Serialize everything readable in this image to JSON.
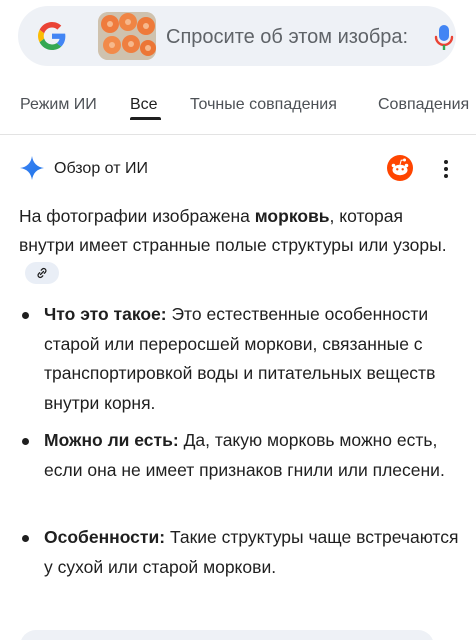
{
  "search": {
    "placeholder": "Спросите об этом изобра:",
    "thumbnail_alt": "carrot-slices-thumbnail"
  },
  "tabs": [
    {
      "label": "Режим ИИ",
      "active": false
    },
    {
      "label": "Все",
      "active": true
    },
    {
      "label": "Точные совпадения",
      "active": false
    },
    {
      "label": "Совпадения",
      "active": false
    }
  ],
  "ai_overview": {
    "title": "Обзор от ИИ",
    "intro_before": "На фотографии изображена ",
    "intro_bold": "морковь",
    "intro_after": ", которая внутри имеет странные полые структуры или узоры.",
    "bullets": [
      {
        "term": "Что это такое:",
        "text": " Это естественные особенности старой или переросшей моркови, связанные с транспортировкой воды и питательных веществ внутри корня."
      },
      {
        "term": "Можно ли есть:",
        "text": " Да, такую морковь можно есть, если она не имеет признаков гнили или плесени."
      },
      {
        "term": "Особенности:",
        "text": " Такие структуры чаще встречаются у сухой или старой моркови."
      }
    ]
  },
  "colors": {
    "google_blue": "#4285F4",
    "google_red": "#EA4335",
    "google_yellow": "#FBBC05",
    "google_green": "#34A853",
    "reddit_orange": "#FF4500",
    "search_bg": "#eef1f6"
  }
}
